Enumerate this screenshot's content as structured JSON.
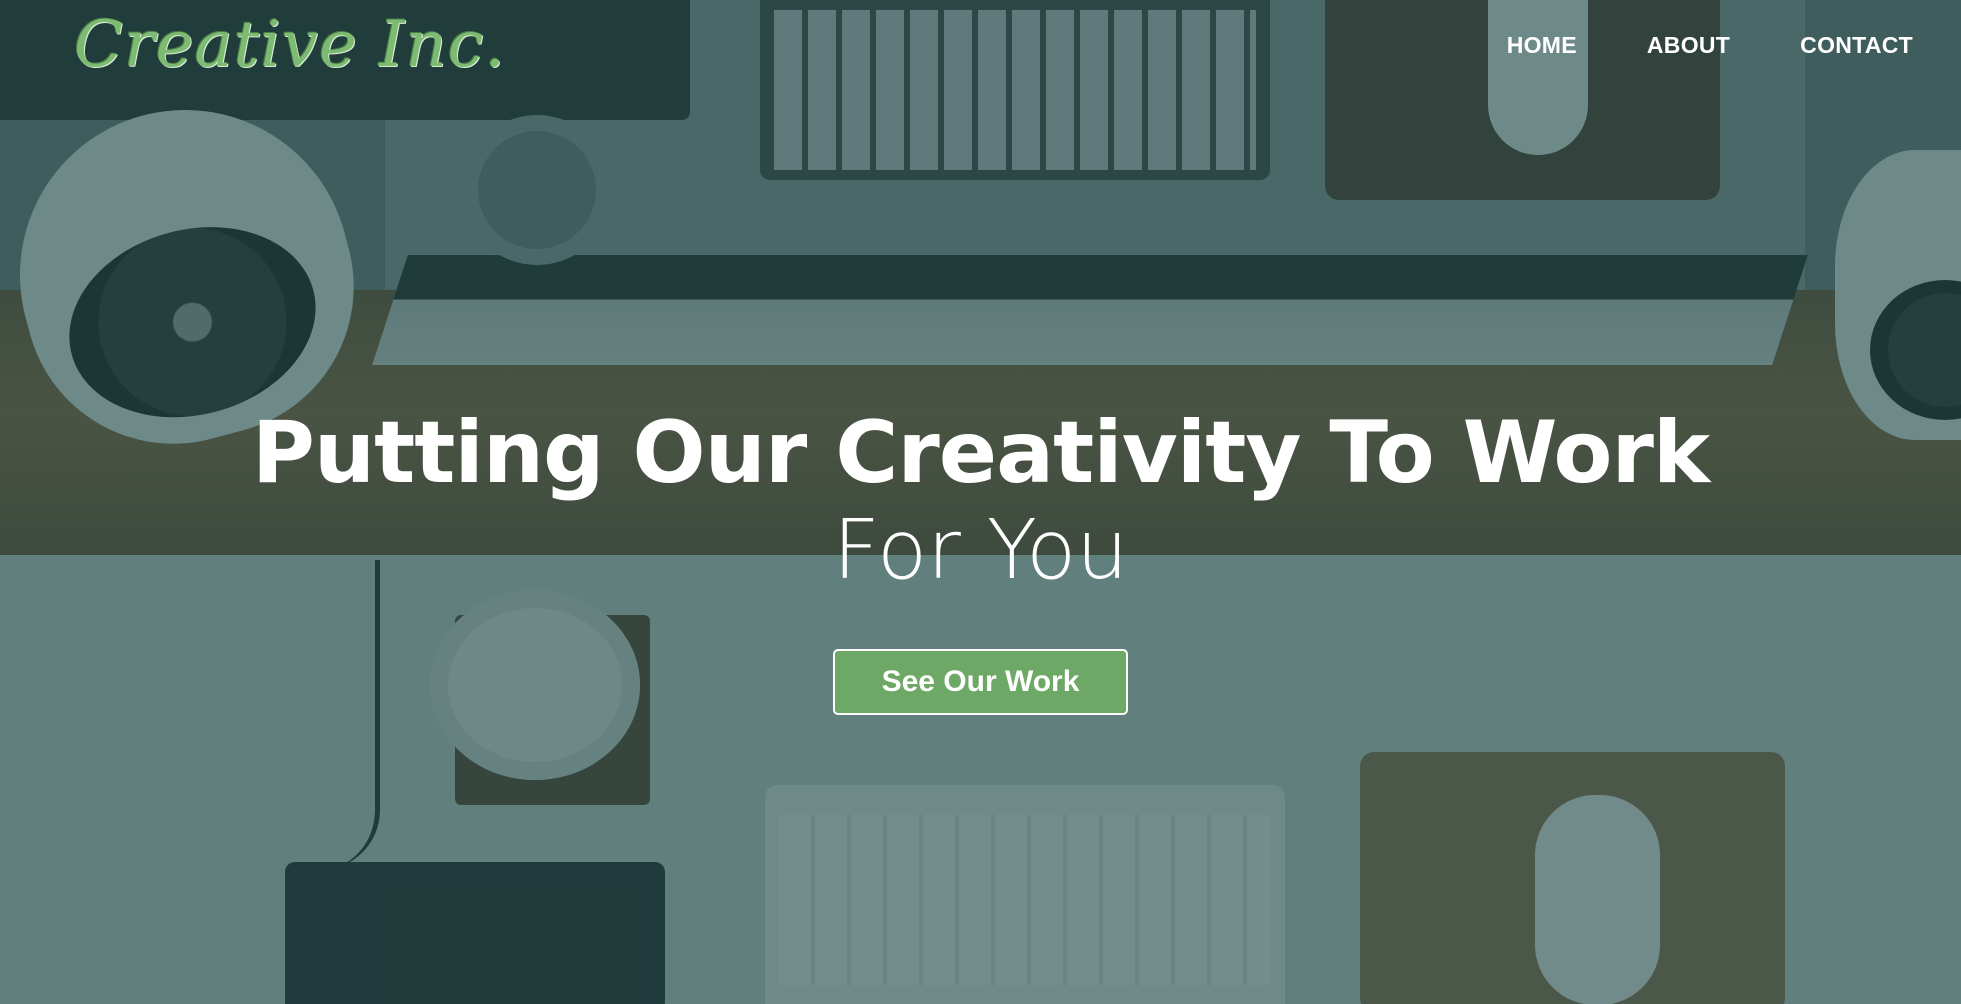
{
  "header": {
    "logo_text": "Creative Inc.",
    "nav": [
      {
        "label": "HOME"
      },
      {
        "label": "ABOUT"
      },
      {
        "label": "CONTACT"
      }
    ]
  },
  "hero": {
    "title": "Putting Our Creativity To Work",
    "subtitle": "For You",
    "cta_label": "See Our Work"
  },
  "colors": {
    "accent_green": "#6da866",
    "logo_green": "#7dbb73",
    "overlay_teal": "#224e4c",
    "text": "#ffffff"
  }
}
